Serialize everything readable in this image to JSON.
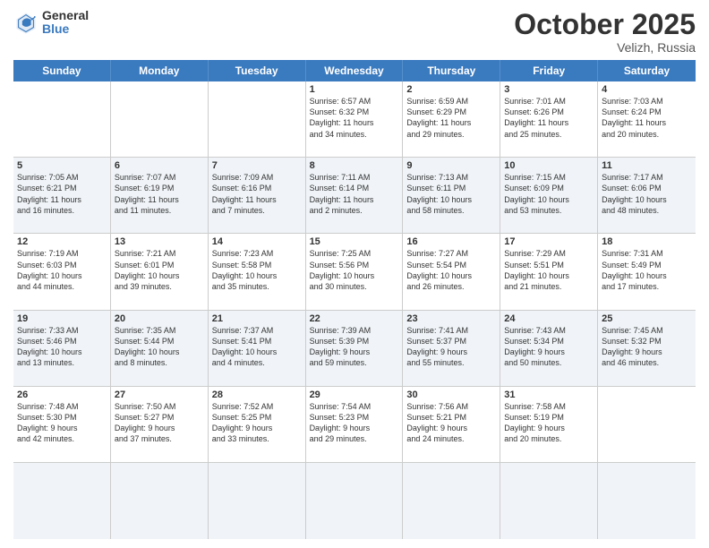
{
  "logo": {
    "general": "General",
    "blue": "Blue"
  },
  "header": {
    "month": "October 2025",
    "location": "Velizh, Russia"
  },
  "weekdays": [
    "Sunday",
    "Monday",
    "Tuesday",
    "Wednesday",
    "Thursday",
    "Friday",
    "Saturday"
  ],
  "rows": [
    [
      {
        "day": "",
        "text": ""
      },
      {
        "day": "",
        "text": ""
      },
      {
        "day": "",
        "text": ""
      },
      {
        "day": "1",
        "text": "Sunrise: 6:57 AM\nSunset: 6:32 PM\nDaylight: 11 hours\nand 34 minutes."
      },
      {
        "day": "2",
        "text": "Sunrise: 6:59 AM\nSunset: 6:29 PM\nDaylight: 11 hours\nand 29 minutes."
      },
      {
        "day": "3",
        "text": "Sunrise: 7:01 AM\nSunset: 6:26 PM\nDaylight: 11 hours\nand 25 minutes."
      },
      {
        "day": "4",
        "text": "Sunrise: 7:03 AM\nSunset: 6:24 PM\nDaylight: 11 hours\nand 20 minutes."
      }
    ],
    [
      {
        "day": "5",
        "text": "Sunrise: 7:05 AM\nSunset: 6:21 PM\nDaylight: 11 hours\nand 16 minutes."
      },
      {
        "day": "6",
        "text": "Sunrise: 7:07 AM\nSunset: 6:19 PM\nDaylight: 11 hours\nand 11 minutes."
      },
      {
        "day": "7",
        "text": "Sunrise: 7:09 AM\nSunset: 6:16 PM\nDaylight: 11 hours\nand 7 minutes."
      },
      {
        "day": "8",
        "text": "Sunrise: 7:11 AM\nSunset: 6:14 PM\nDaylight: 11 hours\nand 2 minutes."
      },
      {
        "day": "9",
        "text": "Sunrise: 7:13 AM\nSunset: 6:11 PM\nDaylight: 10 hours\nand 58 minutes."
      },
      {
        "day": "10",
        "text": "Sunrise: 7:15 AM\nSunset: 6:09 PM\nDaylight: 10 hours\nand 53 minutes."
      },
      {
        "day": "11",
        "text": "Sunrise: 7:17 AM\nSunset: 6:06 PM\nDaylight: 10 hours\nand 48 minutes."
      }
    ],
    [
      {
        "day": "12",
        "text": "Sunrise: 7:19 AM\nSunset: 6:03 PM\nDaylight: 10 hours\nand 44 minutes."
      },
      {
        "day": "13",
        "text": "Sunrise: 7:21 AM\nSunset: 6:01 PM\nDaylight: 10 hours\nand 39 minutes."
      },
      {
        "day": "14",
        "text": "Sunrise: 7:23 AM\nSunset: 5:58 PM\nDaylight: 10 hours\nand 35 minutes."
      },
      {
        "day": "15",
        "text": "Sunrise: 7:25 AM\nSunset: 5:56 PM\nDaylight: 10 hours\nand 30 minutes."
      },
      {
        "day": "16",
        "text": "Sunrise: 7:27 AM\nSunset: 5:54 PM\nDaylight: 10 hours\nand 26 minutes."
      },
      {
        "day": "17",
        "text": "Sunrise: 7:29 AM\nSunset: 5:51 PM\nDaylight: 10 hours\nand 21 minutes."
      },
      {
        "day": "18",
        "text": "Sunrise: 7:31 AM\nSunset: 5:49 PM\nDaylight: 10 hours\nand 17 minutes."
      }
    ],
    [
      {
        "day": "19",
        "text": "Sunrise: 7:33 AM\nSunset: 5:46 PM\nDaylight: 10 hours\nand 13 minutes."
      },
      {
        "day": "20",
        "text": "Sunrise: 7:35 AM\nSunset: 5:44 PM\nDaylight: 10 hours\nand 8 minutes."
      },
      {
        "day": "21",
        "text": "Sunrise: 7:37 AM\nSunset: 5:41 PM\nDaylight: 10 hours\nand 4 minutes."
      },
      {
        "day": "22",
        "text": "Sunrise: 7:39 AM\nSunset: 5:39 PM\nDaylight: 9 hours\nand 59 minutes."
      },
      {
        "day": "23",
        "text": "Sunrise: 7:41 AM\nSunset: 5:37 PM\nDaylight: 9 hours\nand 55 minutes."
      },
      {
        "day": "24",
        "text": "Sunrise: 7:43 AM\nSunset: 5:34 PM\nDaylight: 9 hours\nand 50 minutes."
      },
      {
        "day": "25",
        "text": "Sunrise: 7:45 AM\nSunset: 5:32 PM\nDaylight: 9 hours\nand 46 minutes."
      }
    ],
    [
      {
        "day": "26",
        "text": "Sunrise: 7:48 AM\nSunset: 5:30 PM\nDaylight: 9 hours\nand 42 minutes."
      },
      {
        "day": "27",
        "text": "Sunrise: 7:50 AM\nSunset: 5:27 PM\nDaylight: 9 hours\nand 37 minutes."
      },
      {
        "day": "28",
        "text": "Sunrise: 7:52 AM\nSunset: 5:25 PM\nDaylight: 9 hours\nand 33 minutes."
      },
      {
        "day": "29",
        "text": "Sunrise: 7:54 AM\nSunset: 5:23 PM\nDaylight: 9 hours\nand 29 minutes."
      },
      {
        "day": "30",
        "text": "Sunrise: 7:56 AM\nSunset: 5:21 PM\nDaylight: 9 hours\nand 24 minutes."
      },
      {
        "day": "31",
        "text": "Sunrise: 7:58 AM\nSunset: 5:19 PM\nDaylight: 9 hours\nand 20 minutes."
      },
      {
        "day": "",
        "text": ""
      }
    ],
    [
      {
        "day": "",
        "text": ""
      },
      {
        "day": "",
        "text": ""
      },
      {
        "day": "",
        "text": ""
      },
      {
        "day": "",
        "text": ""
      },
      {
        "day": "",
        "text": ""
      },
      {
        "day": "",
        "text": ""
      },
      {
        "day": "",
        "text": ""
      }
    ]
  ]
}
